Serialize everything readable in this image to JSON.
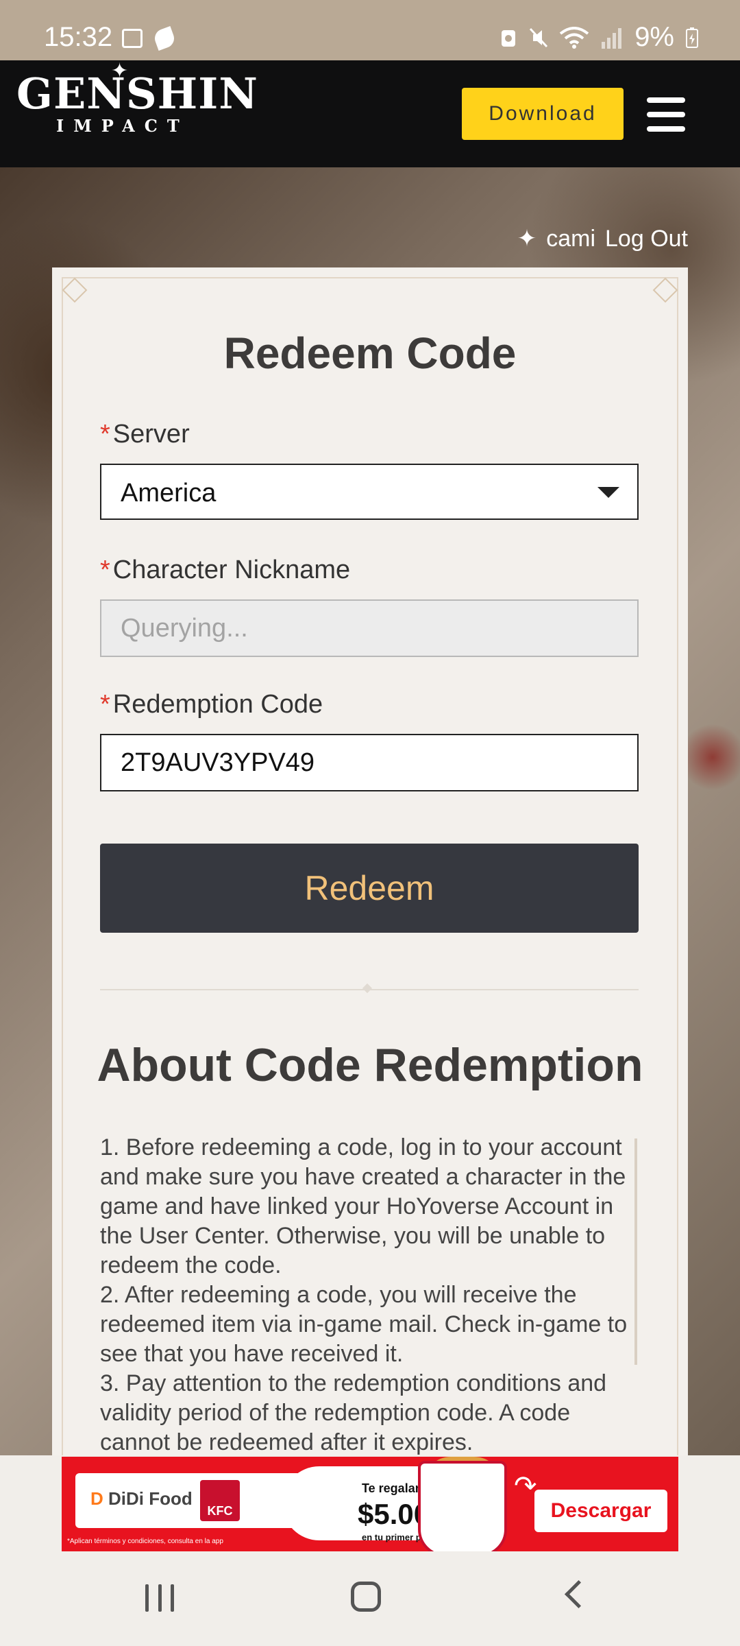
{
  "status_bar": {
    "time": "15:32",
    "battery": "9%",
    "icons": [
      "gallery-icon",
      "leaf-icon",
      "battery-saver-icon",
      "mute-icon",
      "wifi-icon",
      "signal-icon",
      "battery-icon"
    ]
  },
  "header": {
    "logo_main": "GENSHIN",
    "logo_sub": "IMPACT",
    "download_label": "Download",
    "menu_icon": "hamburger-menu-icon"
  },
  "user": {
    "star": "✦",
    "name": "cami",
    "logout": "Log Out"
  },
  "form": {
    "title": "Redeem Code",
    "required_mark": "*",
    "server_label": "Server",
    "server_value": "America",
    "nickname_label": "Character Nickname",
    "nickname_placeholder": "Querying...",
    "code_label": "Redemption Code",
    "code_value": "2T9AUV3YPV49",
    "redeem_label": "Redeem"
  },
  "about": {
    "title": "About Code Redemption",
    "items": [
      "1. Before redeeming a code, log in to your account and make sure you have created a character in the game and have linked your HoYoverse Account in the User Center. Otherwise, you will be unable to redeem the code.",
      "2. After redeeming a code, you will receive the redeemed item via in-game mail. Check in-game to see that you have received it.",
      "3. Pay attention to the redemption conditions and validity period of the redemption code. A code cannot be redeemed after it expires."
    ]
  },
  "ad": {
    "brand_didi": "DiDi Food",
    "brand_kfc": "KFC",
    "promo_top": "Te regalamos",
    "promo_amount": "$5.000",
    "promo_bottom": "en tu primer pedido",
    "cta": "Descargar",
    "fine_print": "*Aplican términos y condiciones, consulta en la app"
  },
  "colors": {
    "download_button": "#ffd21a",
    "redeem_button": "#36383f",
    "redeem_text": "#f1c17a",
    "required": "#e0392b",
    "ad_red": "#e8131f"
  }
}
